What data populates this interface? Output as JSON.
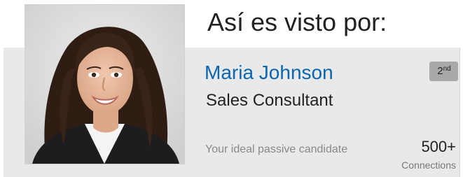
{
  "heading": "Así es visto por:",
  "profile": {
    "name": "Maria Johnson",
    "title": "Sales Consultant",
    "degree": {
      "number": "2",
      "suffix": "nd"
    },
    "tagline": "Your ideal passive candidate",
    "connections": {
      "count": "500+",
      "label": "Connections"
    },
    "photo_icon": "profile-photo"
  },
  "colors": {
    "name_link": "#0a66b0",
    "card_bg": "#e9e9e9",
    "badge_bg": "#a9a9a9"
  }
}
